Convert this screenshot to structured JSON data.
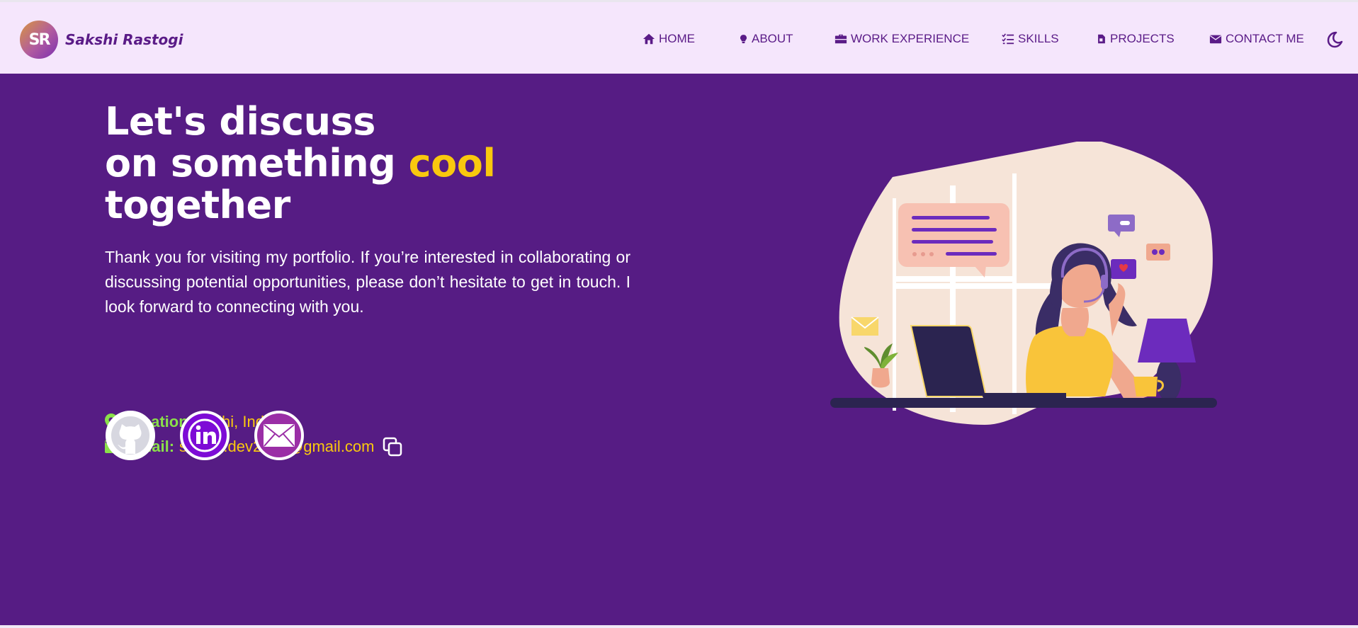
{
  "brand": {
    "initials": "SR",
    "name": "Sakshi Rastogi"
  },
  "nav": {
    "items": [
      {
        "label": "HOME",
        "icon": "home-icon"
      },
      {
        "label": "ABOUT",
        "icon": "lightbulb-icon"
      },
      {
        "label": "WORK EXPERIENCE",
        "icon": "briefcase-icon"
      },
      {
        "label": "SKILLS",
        "icon": "list-check-icon"
      },
      {
        "label": "PROJECTS",
        "icon": "file-icon"
      },
      {
        "label": "CONTACT ME",
        "icon": "envelope-icon"
      }
    ],
    "theme_toggle_icon": "moon-icon"
  },
  "hero": {
    "headline_line1": "Let's discuss",
    "headline_line2_prefix": "on something ",
    "headline_highlight": "cool",
    "headline_line3": "together",
    "intro": "Thank you for visiting my portfolio. If you’re interested in collaborating or discussing potential opportunities, please don’t hesitate to get in touch. I look forward to connecting with you.",
    "location_label": "Location:",
    "location_value": "Delhi, India",
    "email_label": "Email:",
    "email_value": "sakshi.dev2020@gmail.com",
    "social": [
      {
        "name": "github",
        "icon": "github-icon"
      },
      {
        "name": "linkedin",
        "icon": "linkedin-icon"
      },
      {
        "name": "email",
        "icon": "mail-icon"
      }
    ]
  },
  "colors": {
    "nav_bg": "#f5e6fc",
    "nav_text": "#5a1b87",
    "hero_bg": "#561c84",
    "highlight": "#f9c80e",
    "label_green": "#8ae04a"
  }
}
